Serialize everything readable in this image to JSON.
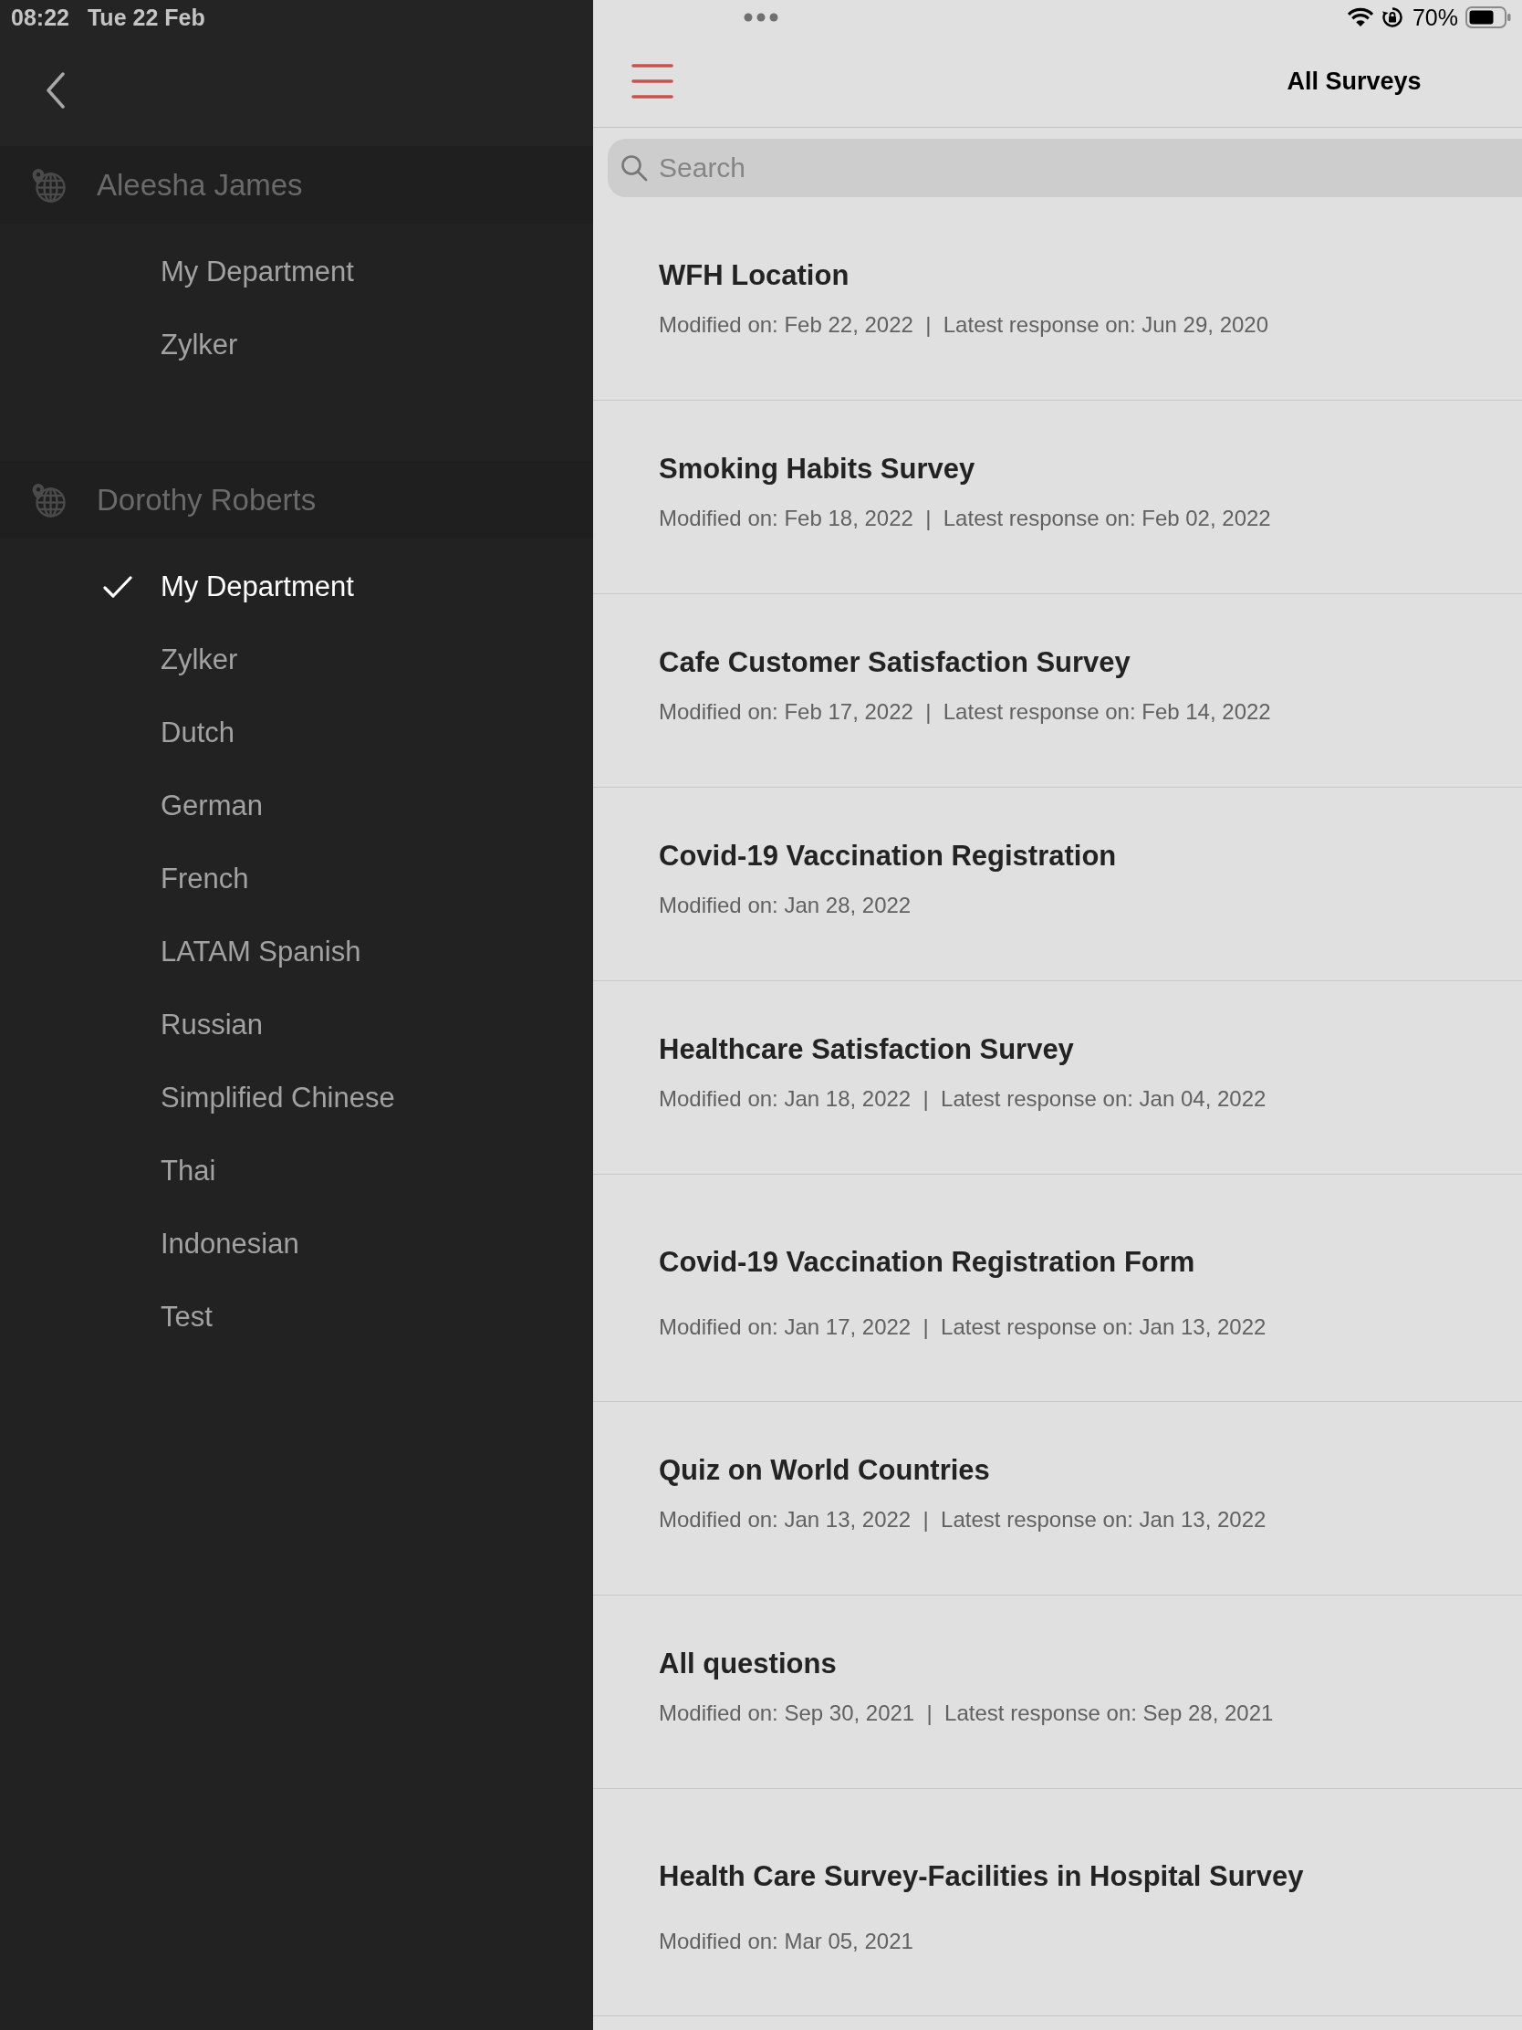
{
  "status_bar": {
    "time": "08:22",
    "date": "Tue 22 Feb",
    "battery": "70%"
  },
  "sidebar": {
    "accounts": [
      {
        "name": "Aleesha James",
        "departments": [
          {
            "name": "My Department",
            "selected": false
          },
          {
            "name": "Zylker",
            "selected": false
          }
        ]
      },
      {
        "name": "Dorothy Roberts",
        "departments": [
          {
            "name": "My Department",
            "selected": true
          },
          {
            "name": "Zylker",
            "selected": false
          },
          {
            "name": "Dutch",
            "selected": false
          },
          {
            "name": "German",
            "selected": false
          },
          {
            "name": "French",
            "selected": false
          },
          {
            "name": "LATAM Spanish",
            "selected": false
          },
          {
            "name": "Russian",
            "selected": false
          },
          {
            "name": "Simplified Chinese",
            "selected": false
          },
          {
            "name": "Thai",
            "selected": false
          },
          {
            "name": "Indonesian",
            "selected": false
          },
          {
            "name": "Test",
            "selected": false
          }
        ]
      }
    ]
  },
  "header": {
    "title": "All Surveys"
  },
  "search": {
    "placeholder": "Search"
  },
  "surveys": [
    {
      "title": "WFH Location",
      "meta": "Modified on: Feb 22, 2022  |  Latest response on: Jun 29, 2020"
    },
    {
      "title": "Smoking Habits Survey",
      "meta": "Modified on: Feb 18, 2022  |  Latest response on: Feb 02, 2022"
    },
    {
      "title": "Cafe Customer Satisfaction Survey",
      "meta": "Modified on: Feb 17, 2022  |  Latest response on: Feb 14, 2022"
    },
    {
      "title": "Covid-19 Vaccination Registration",
      "meta": "Modified on: Jan 28, 2022"
    },
    {
      "title": "Healthcare Satisfaction Survey",
      "meta": "Modified on: Jan 18, 2022  |  Latest response on: Jan 04, 2022"
    },
    {
      "title": "Covid-19 Vaccination Registration Form",
      "meta": "Modified on: Jan 17, 2022  |  Latest response on: Jan 13, 2022"
    },
    {
      "title": "Quiz on World Countries",
      "meta": "Modified on: Jan 13, 2022  |  Latest response on: Jan 13, 2022"
    },
    {
      "title": "All questions",
      "meta": "Modified on: Sep 30, 2021  |  Latest response on: Sep 28, 2021"
    },
    {
      "title": "Health Care Survey-Facilities in Hospital Survey",
      "meta": "Modified on: Mar 05, 2021"
    }
  ]
}
